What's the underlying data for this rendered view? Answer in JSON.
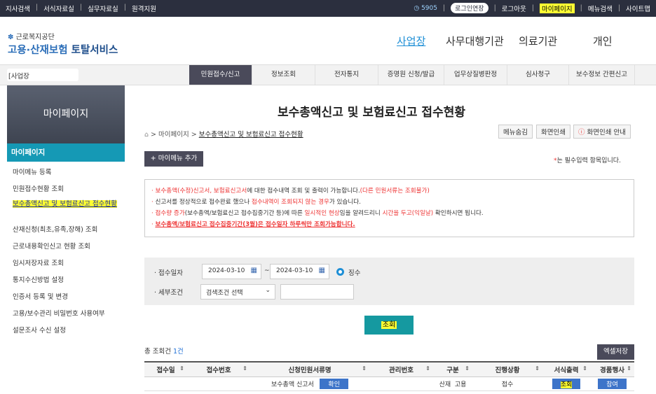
{
  "topbar": {
    "left_links": [
      "지사검색",
      "서식자료실",
      "실무자료실",
      "원격지원"
    ],
    "timer": "5905",
    "extend_label": "로그인연장",
    "logout": "로그아웃",
    "mypage": "마이페이지",
    "menu_search": "메뉴검색",
    "sitemap": "사이트맵"
  },
  "header": {
    "org": "근로복지공단",
    "service_part1": "고용·산재보험",
    "service_part2": " 토탈서비스",
    "nav": [
      "사업장",
      "사무대행기관",
      "의료기관",
      "개인"
    ]
  },
  "gnb": {
    "crumb": "[사업장",
    "items": [
      "민원접수/신고",
      "정보조회",
      "전자통지",
      "증명원 신청/발급",
      "업무상질병판정",
      "심사청구",
      "보수정보 간편신고"
    ]
  },
  "sidebar": {
    "banner": "마이페이지",
    "title": "마이페이지",
    "items": [
      "마이메뉴 등록",
      "민원접수현황 조회",
      "보수총액신고 및 보험료신고 접수현황",
      "산재신청(최초,유족,장해) 조회",
      "근로내용확인신고 현황 조회",
      "임시저장자료 조회",
      "통지수신방법 설정",
      "인증서 등록 및 변경",
      "고용/보수관리 비밀번호 사용여부",
      "설문조사 수신 설정"
    ]
  },
  "main": {
    "title": "보수총액신고 및 보험료신고 접수현황",
    "breadcrumb_1": "마이페이지",
    "breadcrumb_2": "보수총액신고 및 보험료신고 접수현황",
    "btn_hide_menu": "메뉴숨김",
    "btn_print": "화면인쇄",
    "btn_print_guide": "화면인쇄 안내",
    "add_my_menu": "+ 마이메뉴 추가",
    "required_note_star": "*",
    "required_note": "는 필수입력 항목입니다.",
    "notice": {
      "l1_red": "보수총액(수정)신고서, 보험료신고서",
      "l1_rest": "에 대한 접수내역 조회 및 출력이 가능합니다.",
      "l1_red2": "(다른 민원서류는 조회불가)",
      "l2_a": "신고서를 정상적으로 접수완료 했으나 ",
      "l2_red": "접수내역이 조회되지 않는 경우",
      "l2_b": "가 있습니다.",
      "l3_red": "접수량 증가",
      "l3_a": "(보수총액/보험료신고 접수집중기간 등)에 따른 ",
      "l3_red2": "일시적인 현상",
      "l3_b": "임을 알려드리니 ",
      "l3_red3": "시간을 두고(익일날)",
      "l3_c": " 확인하시면 됩니다.",
      "l4": "보수총액/보험료신고 접수집중기간(3월)은 접수일자 하루씩만 조회가능합니다."
    },
    "search": {
      "date_label": "· 접수일자",
      "date_from": "2024-03-10",
      "date_to": "2024-03-10",
      "tilde": "~",
      "radio_label": "징수",
      "cond_label": "· 세부조건",
      "cond_select": "검색조건 선택",
      "query_button": "조회"
    },
    "total_label": "총 조회건 ",
    "total_count": "1건",
    "excel_button": "엑셀저장",
    "table": {
      "headers": [
        "접수일",
        "접수번호",
        "신청민원서류명",
        "관리번호",
        "구분",
        "진행상황",
        "서식출력",
        "경품행사"
      ],
      "row": {
        "doc_name": "보수총액 신고서",
        "confirm": "확인",
        "type1": "산재",
        "type2": "고용",
        "status": "접수",
        "print": "조회",
        "event": "참여"
      }
    }
  }
}
